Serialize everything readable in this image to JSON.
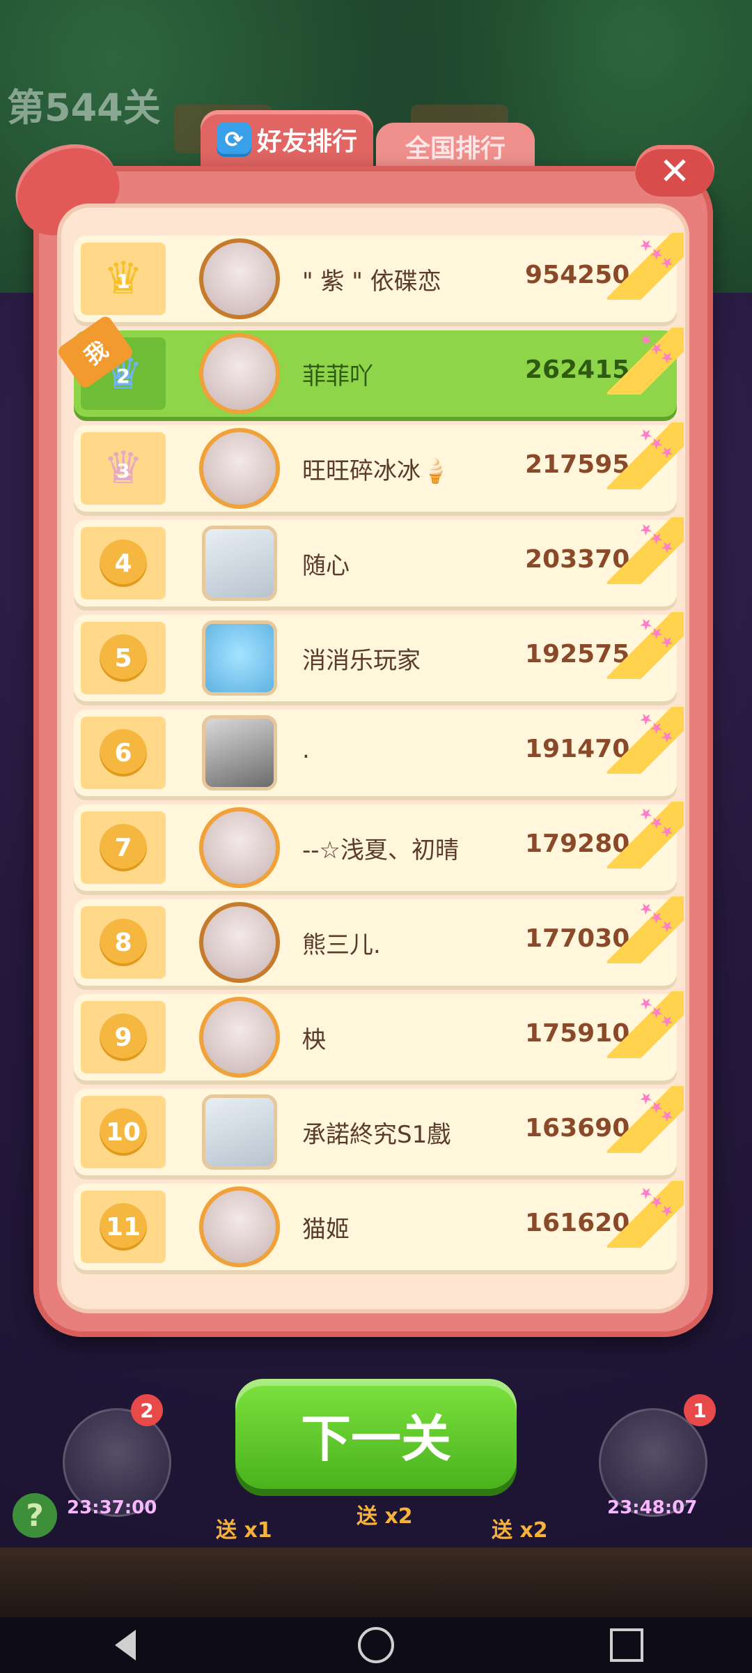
{
  "background": {
    "level_label": "第544关"
  },
  "tabs": {
    "friends_label": "好友排行",
    "national_label": "全国排行",
    "refresh_icon": "refresh-icon"
  },
  "close": {
    "symbol": "✕"
  },
  "me_badge": "我",
  "leaderboard": [
    {
      "rank": "1",
      "name": "\" 紫 \" 依碟恋",
      "score": "954250",
      "crown": "gold"
    },
    {
      "rank": "2",
      "name": "菲菲吖",
      "score": "262415",
      "crown": "blue",
      "me": true
    },
    {
      "rank": "3",
      "name": "旺旺碎冰冰🍦",
      "score": "217595",
      "crown": "pink"
    },
    {
      "rank": "4",
      "name": "随心",
      "score": "203370"
    },
    {
      "rank": "5",
      "name": "消消乐玩家",
      "score": "192575"
    },
    {
      "rank": "6",
      "name": ".",
      "score": "191470"
    },
    {
      "rank": "7",
      "name": "--☆浅夏、初晴",
      "score": "179280"
    },
    {
      "rank": "8",
      "name": "熊三儿.",
      "score": "177030"
    },
    {
      "rank": "9",
      "name": "柍",
      "score": "175910"
    },
    {
      "rank": "10",
      "name": "承諾終究S1戲",
      "score": "163690"
    },
    {
      "rank": "11",
      "name": "猫姬",
      "score": "161620"
    }
  ],
  "next_button": "下一关",
  "bottom": {
    "badge_left": "2",
    "badge_right": "1",
    "timer_left": "23:37:00",
    "timer_right": "23:48:07",
    "send_label": "送",
    "send_1": "x1",
    "send_2": "x2",
    "send_3": "x2",
    "help": "?"
  },
  "colors": {
    "panel": "#e77f7d",
    "row": "#fff6dc",
    "me_row": "#8fd54a",
    "next_btn": "#5cc72a"
  }
}
